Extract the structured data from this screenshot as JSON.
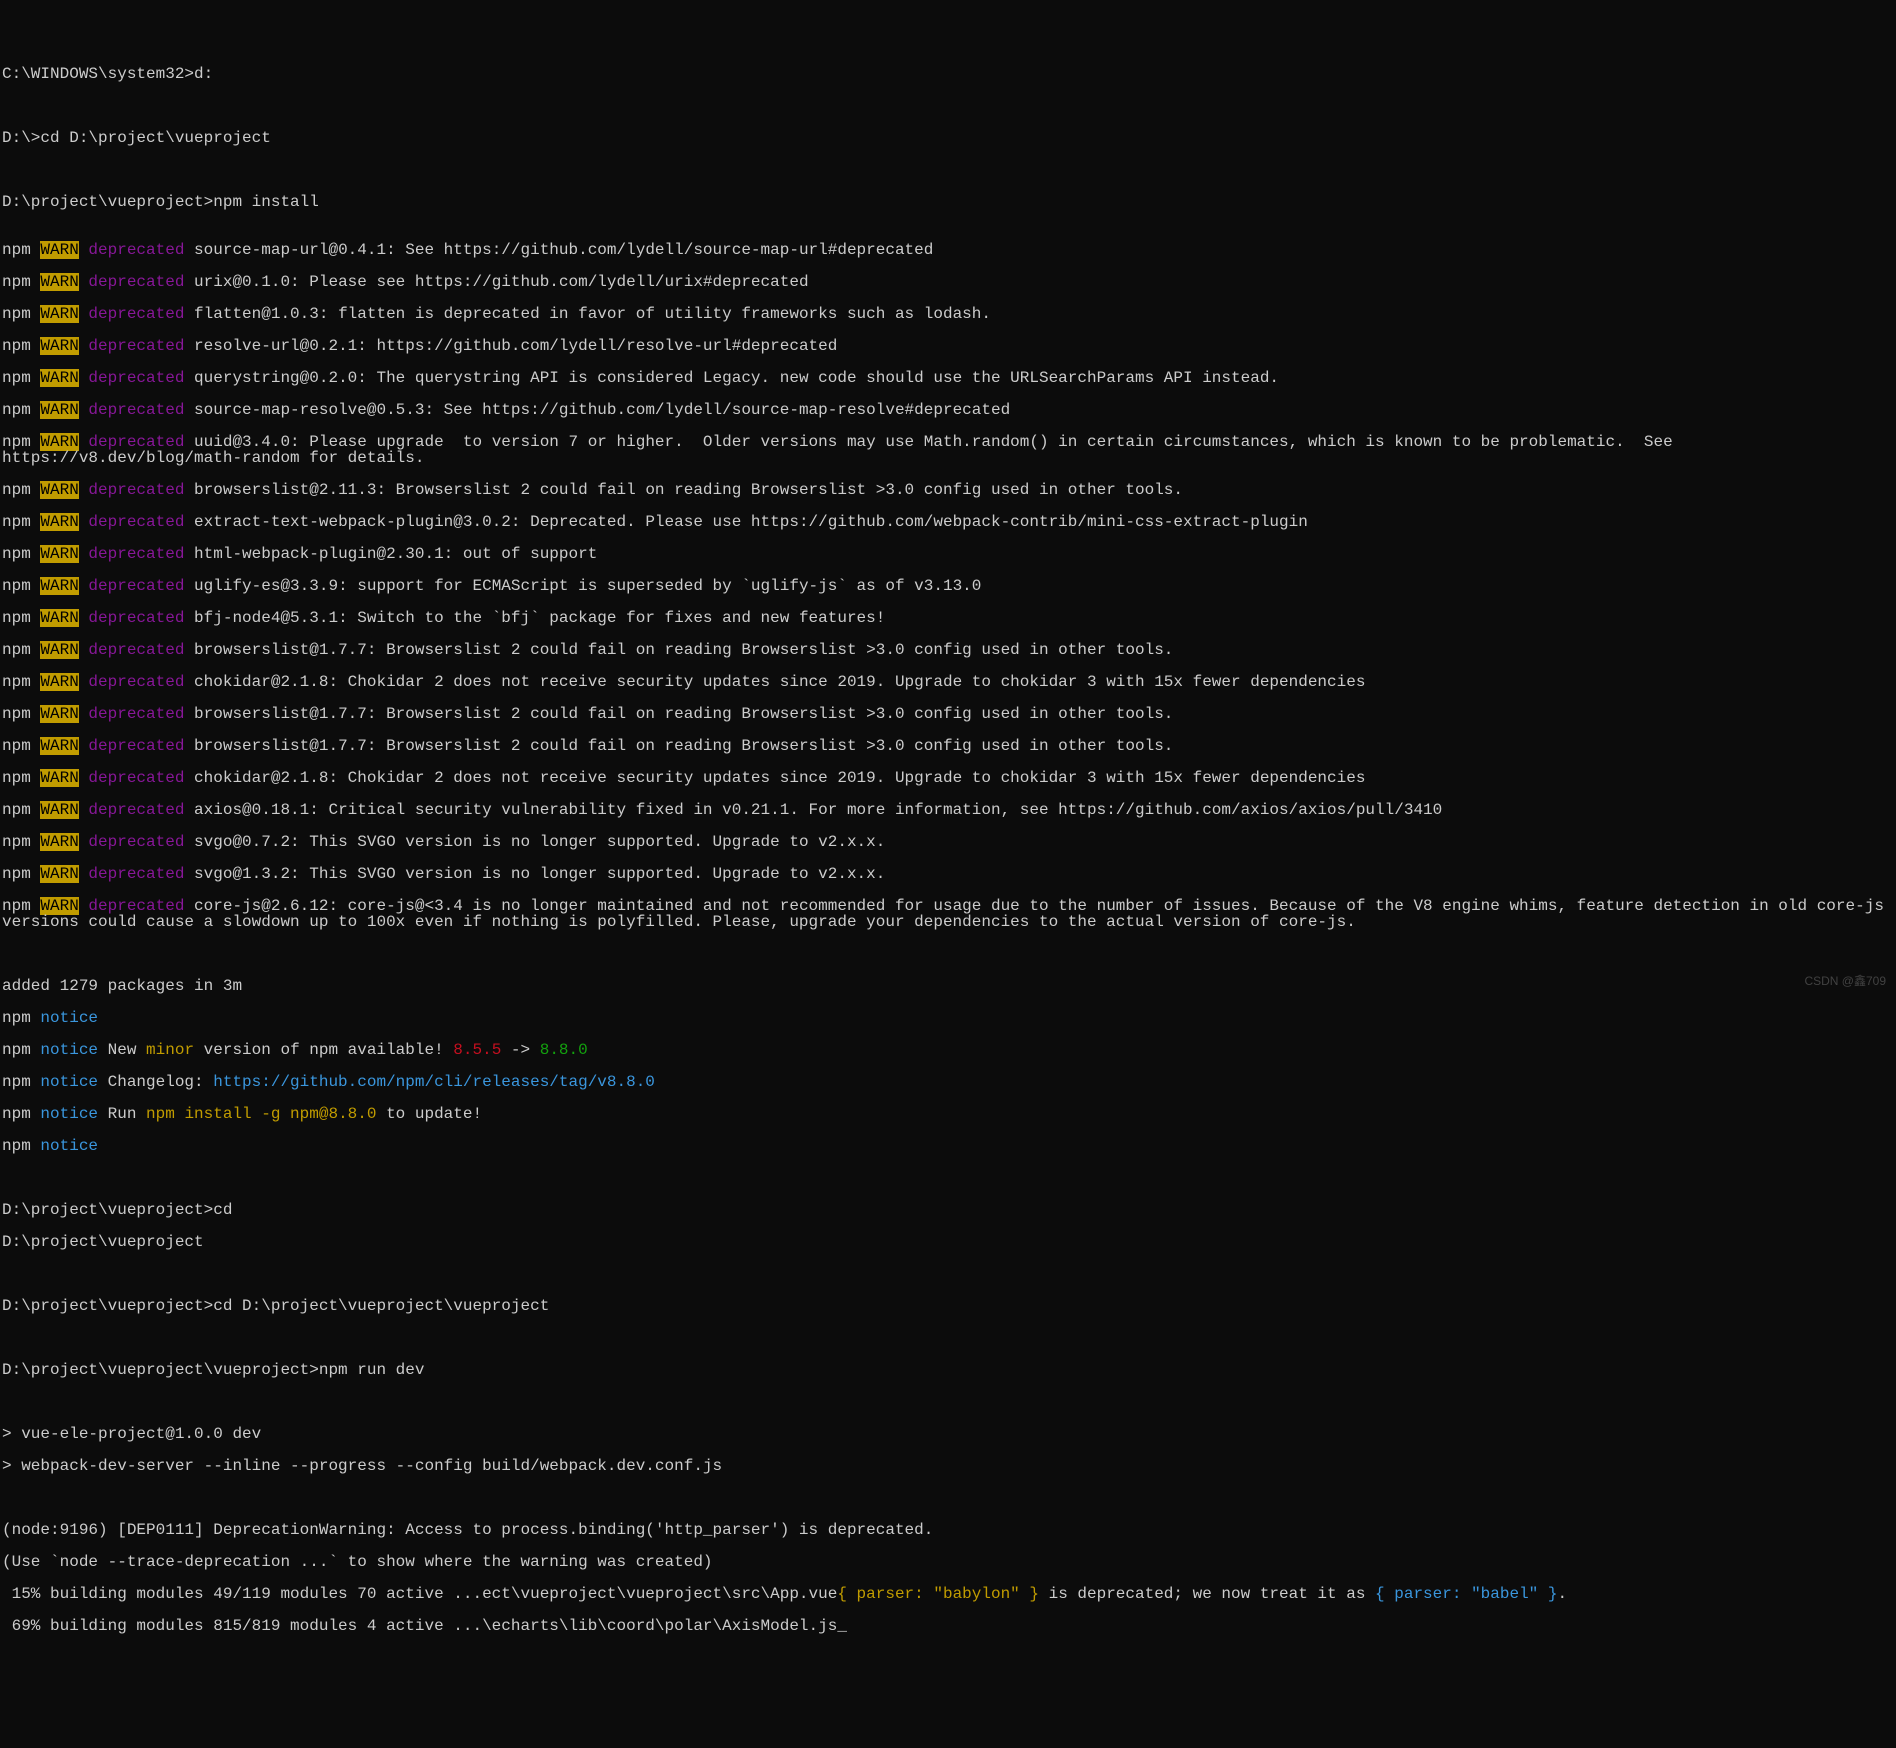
{
  "prompts": {
    "p0": "C:\\WINDOWS\\system32>d:",
    "p1": "D:\\>cd D:\\project\\vueproject",
    "p2": "D:\\project\\vueproject>npm install",
    "p3": "D:\\project\\vueproject>cd",
    "p4": "D:\\project\\vueproject",
    "p5": "D:\\project\\vueproject>cd D:\\project\\vueproject\\vueproject",
    "p6": "D:\\project\\vueproject\\vueproject>npm run dev"
  },
  "labels": {
    "npm": "npm ",
    "warn": "WARN",
    "space": " ",
    "deprecated": "deprecated",
    "notice": "notice",
    "minor": "minor"
  },
  "warns": {
    "w0": " source-map-url@0.4.1: See https://github.com/lydell/source-map-url#deprecated",
    "w1": " urix@0.1.0: Please see https://github.com/lydell/urix#deprecated",
    "w2": " flatten@1.0.3: flatten is deprecated in favor of utility frameworks such as lodash.",
    "w3": " resolve-url@0.2.1: https://github.com/lydell/resolve-url#deprecated",
    "w4": " querystring@0.2.0: The querystring API is considered Legacy. new code should use the URLSearchParams API instead.",
    "w5": " source-map-resolve@0.5.3: See https://github.com/lydell/source-map-resolve#deprecated",
    "w6": " uuid@3.4.0: Please upgrade  to version 7 or higher.  Older versions may use Math.random() in certain circumstances, which is known to be problematic.  See https://v8.dev/blog/math-random for details.",
    "w7": " browserslist@2.11.3: Browserslist 2 could fail on reading Browserslist >3.0 config used in other tools.",
    "w8": " extract-text-webpack-plugin@3.0.2: Deprecated. Please use https://github.com/webpack-contrib/mini-css-extract-plugin",
    "w9": " html-webpack-plugin@2.30.1: out of support",
    "w10": " uglify-es@3.3.9: support for ECMAScript is superseded by `uglify-js` as of v3.13.0",
    "w11": " bfj-node4@5.3.1: Switch to the `bfj` package for fixes and new features!",
    "w12": " browserslist@1.7.7: Browserslist 2 could fail on reading Browserslist >3.0 config used in other tools.",
    "w13": " chokidar@2.1.8: Chokidar 2 does not receive security updates since 2019. Upgrade to chokidar 3 with 15x fewer dependencies",
    "w14": " browserslist@1.7.7: Browserslist 2 could fail on reading Browserslist >3.0 config used in other tools.",
    "w15": " browserslist@1.7.7: Browserslist 2 could fail on reading Browserslist >3.0 config used in other tools.",
    "w16": " chokidar@2.1.8: Chokidar 2 does not receive security updates since 2019. Upgrade to chokidar 3 with 15x fewer dependencies",
    "w17": " axios@0.18.1: Critical security vulnerability fixed in v0.21.1. For more information, see https://github.com/axios/axios/pull/3410",
    "w18": " svgo@0.7.2: This SVGO version is no longer supported. Upgrade to v2.x.x.",
    "w19": " svgo@1.3.2: This SVGO version is no longer supported. Upgrade to v2.x.x.",
    "w20": " core-js@2.6.12: core-js@<3.4 is no longer maintained and not recommended for usage due to the number of issues. Because of the V8 engine whims, feature detection in old core-js versions could cause a slowdown up to 100x even if nothing is polyfilled. Please, upgrade your dependencies to the actual version of core-js."
  },
  "added": "added 1279 packages in 3m",
  "notice_lines": {
    "n1_pre": " New ",
    "n1_post": " version of npm available! ",
    "oldver": "8.5.5",
    "arrow": " -> ",
    "newver": "8.8.0",
    "n2_pre": " Changelog: ",
    "n2_url": "https://github.com/npm/cli/releases/tag/v8.8.0",
    "n3_pre": " Run ",
    "n3_cmd": "npm install -g npm@8.8.0",
    "n3_post": " to update!"
  },
  "run": {
    "r1": "> vue-ele-project@1.0.0 dev",
    "r2": "> webpack-dev-server --inline --progress --config build/webpack.dev.conf.js"
  },
  "dep": {
    "d1": "(node:9196) [DEP0111] DeprecationWarning: Access to process.binding('http_parser') is deprecated.",
    "d2": "(Use `node --trace-deprecation ...` to show where the warning was created)"
  },
  "build": {
    "b1_pre": " 15% building modules 49/119 modules 70 active ...ect\\vueproject\\vueproject\\src\\App.vue",
    "b1_parser1": "{ parser: \"babylon\" }",
    "b1_mid": " is deprecated; we now treat it as ",
    "b1_parser2": "{ parser: \"babel\" }",
    "b1_end": ".",
    "b2": " 69% building modules 815/819 modules 4 active ...\\echarts\\lib\\coord\\polar\\AxisModel.js"
  },
  "watermark": "CSDN @鑫709",
  "cursor": "_"
}
